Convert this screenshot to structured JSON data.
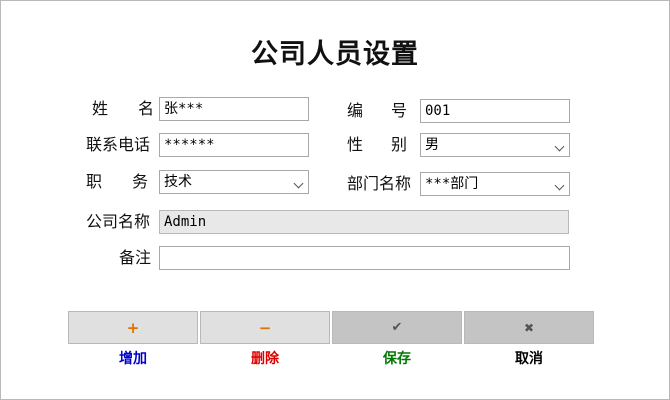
{
  "title": "公司人员设置",
  "form": {
    "name": {
      "label_chars": [
        "姓",
        "名"
      ],
      "value": "张***"
    },
    "number": {
      "label_chars": [
        "编",
        "号"
      ],
      "value": "001"
    },
    "phone": {
      "label": "联系电话",
      "value": "******"
    },
    "gender": {
      "label_chars": [
        "性",
        "别"
      ],
      "value": "男"
    },
    "position": {
      "label_chars": [
        "职",
        "务"
      ],
      "value": "技术"
    },
    "department": {
      "label": "部门名称",
      "value": "***部门"
    },
    "company": {
      "label": "公司名称",
      "value": "Admin"
    },
    "remark": {
      "label": "备注",
      "value": ""
    }
  },
  "buttons": {
    "add": {
      "icon": "+",
      "label": "增加",
      "color": "#0000cc",
      "icon_color": "#e07000"
    },
    "delete": {
      "icon": "−",
      "label": "删除",
      "color": "#dd0000",
      "icon_color": "#e07000"
    },
    "save": {
      "icon": "✔",
      "label": "保存",
      "color": "#007700",
      "icon_color": "#555555"
    },
    "cancel": {
      "icon": "✖",
      "label": "取消",
      "color": "#000000",
      "icon_color": "#555555"
    }
  }
}
